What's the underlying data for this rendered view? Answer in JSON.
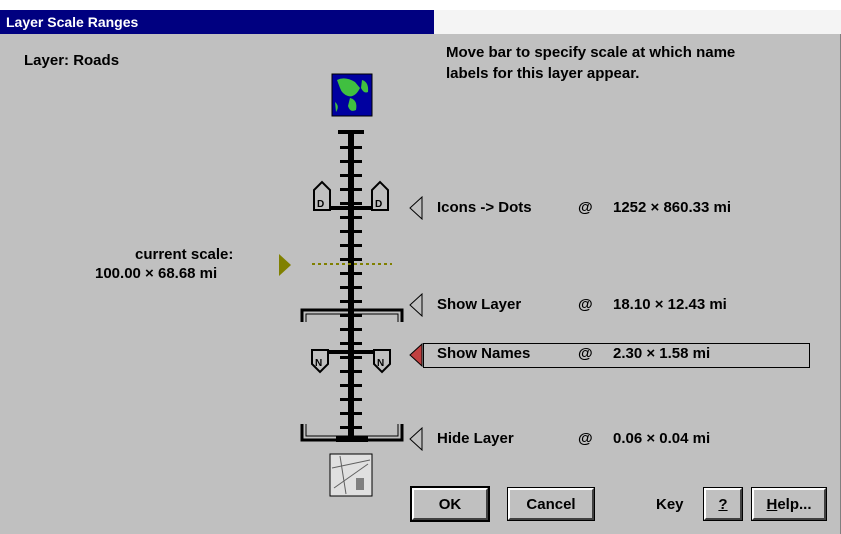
{
  "window": {
    "title": "Layer Scale Ranges"
  },
  "layer": {
    "label": "Layer: Roads"
  },
  "instructions": {
    "line1": "Move bar to specify scale at which name",
    "line2": "labels for this layer appear."
  },
  "current_scale": {
    "label": "current scale:",
    "value": "100.00 × 68.68 mi"
  },
  "rows": [
    {
      "label": "Icons -> Dots",
      "at": "@",
      "scale": "1252 × 860.33 mi"
    },
    {
      "label": "Show Layer",
      "at": "@",
      "scale": "18.10 × 12.43 mi"
    },
    {
      "label": "Show Names",
      "at": "@",
      "scale": "2.30 × 1.58 mi",
      "selected": true
    },
    {
      "label": "Hide Layer",
      "at": "@",
      "scale": "0.06 × 0.04 mi"
    }
  ],
  "buttons": {
    "ok": "OK",
    "cancel": "Cancel",
    "key_label": "Key",
    "key": "?",
    "help_rest": "elp...",
    "help_ul": "H"
  },
  "icons": {
    "world": "world-globe-icon",
    "street_map": "street-map-icon",
    "d_marker": "icons-dots-marker-icon",
    "n_marker": "names-marker-icon",
    "bracket": "layer-bracket-icon"
  },
  "colors": {
    "titlebar": "#000080",
    "face": "#c0c0c0",
    "current_scale": "#808000",
    "selected_pointer": "#c04040"
  }
}
